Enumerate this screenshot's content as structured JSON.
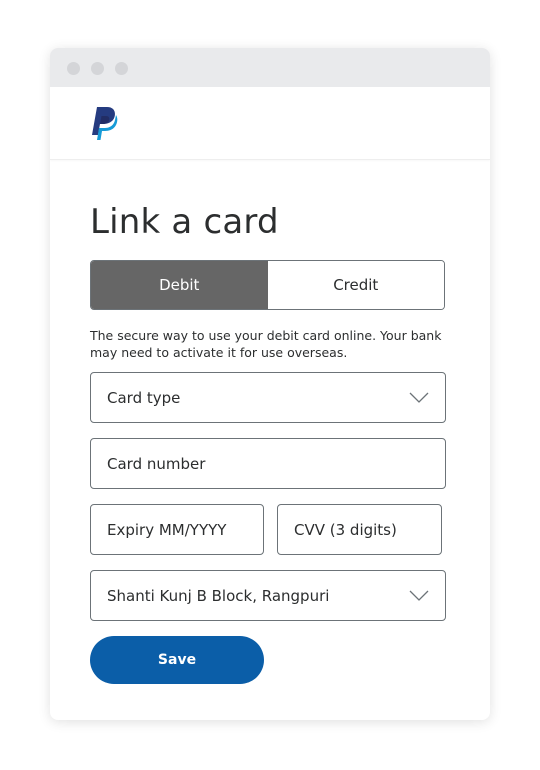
{
  "window": {
    "titlebar_dots": [
      "window-dot",
      "window-dot",
      "window-dot"
    ]
  },
  "header": {
    "logo_icon": "paypal-logo-icon"
  },
  "page": {
    "title": "Link a card",
    "toggle": {
      "options": [
        "Debit",
        "Credit"
      ],
      "selected": "Debit"
    },
    "description": "The secure way to use your debit card online. Your bank may need to activate it for use overseas.",
    "fields": {
      "card_type": {
        "placeholder": "Card type",
        "icon": "chevron-down-icon"
      },
      "card_number": {
        "placeholder": "Card number"
      },
      "expiry": {
        "placeholder": "Expiry MM/YYYY"
      },
      "cvv": {
        "placeholder": "CVV (3 digits)"
      },
      "billing_address": {
        "value": "Shanti Kunj B Block, Rangpuri",
        "icon": "chevron-down-icon"
      }
    },
    "save_label": "Save"
  },
  "colors": {
    "primary_button": "#0b5ea8",
    "toggle_active": "#666666",
    "paypal_dark": "#253b80",
    "paypal_light": "#179bd7"
  }
}
